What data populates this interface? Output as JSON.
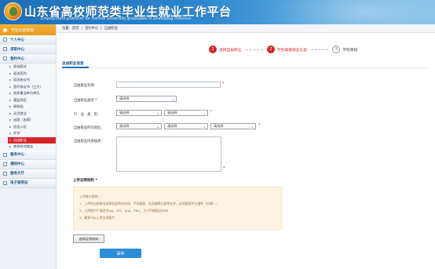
{
  "header": {
    "title": "山东省高校师范类毕业生就业工作平台",
    "subtitle": "Employment platform for normal university graduates in Shandong Province"
  },
  "sidebar": {
    "top": "学生信息管理",
    "items": [
      {
        "label": "个人中心"
      },
      {
        "label": "求职中心"
      },
      {
        "label": "签约中心"
      }
    ],
    "subitems": [
      {
        "label": "双选面试"
      },
      {
        "label": "双选签约"
      },
      {
        "label": "双选协议书"
      },
      {
        "label": "签约协议书（三方）"
      },
      {
        "label": "机关事业单位单位"
      },
      {
        "label": "基层项目"
      },
      {
        "label": "接收函"
      },
      {
        "label": "灵活就业"
      },
      {
        "label": "出国（出境）"
      },
      {
        "label": "应征入伍"
      },
      {
        "label": "升学"
      },
      {
        "label": "自由职业"
      },
      {
        "label": "其他形式就业"
      }
    ],
    "bottom_items": [
      {
        "label": "服务中心"
      },
      {
        "label": "通知中心"
      },
      {
        "label": "服务大厅"
      },
      {
        "label": "电子报到证"
      }
    ]
  },
  "breadcrumb": {
    "prefix": "位置:",
    "items": [
      "首页",
      "签约中心",
      "自由职业"
    ]
  },
  "steps": [
    {
      "num": "1",
      "label": "选择自由职业"
    },
    {
      "num": "2",
      "label": "学生填报就业信息"
    },
    {
      "num": "3",
      "label": "学校审核"
    }
  ],
  "tab": {
    "label": "自由职业信息"
  },
  "form": {
    "name_label": "自由职业名称：",
    "type_label": "自由职业类型 *",
    "industry_label": "行　业　类　型：",
    "location_label": "自由职业所在地区：",
    "desc_label": "自由职业内容描述：",
    "select_placeholder": "请选择",
    "required_mark": "*"
  },
  "upload": {
    "title": "上传证明材料 *",
    "notice": [
      "上传格式说明：",
      "1、上传的自由职业证明包括劳动合同、手机截图、社保缴费记录等文件，必须是原件扫描件（红章）。",
      "2、上传照片扩展名为jpg、JPG、png、PNG，大小不能超过4MB",
      "3、最多可以上传五张照片"
    ],
    "choose_label": "选择证明材料",
    "save_label": "保存"
  }
}
